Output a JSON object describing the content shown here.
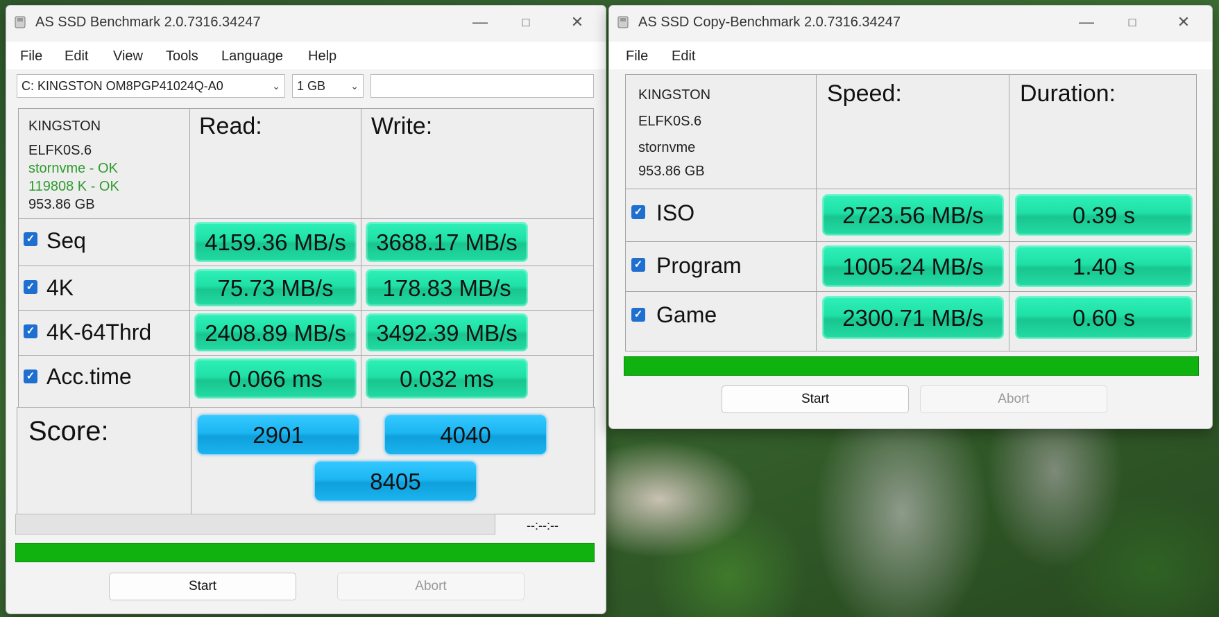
{
  "benchmark": {
    "title": "AS SSD Benchmark 2.0.7316.34247",
    "menu": [
      "File",
      "Edit",
      "View",
      "Tools",
      "Language",
      "Help"
    ],
    "drive_select": "C: KINGSTON OM8PGP41024Q-A0",
    "size_select": "1 GB",
    "info": {
      "model": "KINGSTON",
      "firmware": "ELFK0S.6",
      "driver": "stornvme - OK",
      "alignment": "119808 K - OK",
      "capacity": "953.86 GB"
    },
    "headers": {
      "read": "Read:",
      "write": "Write:"
    },
    "rows": [
      {
        "label": "Seq",
        "checked": true,
        "read": "4159.36 MB/s",
        "write": "3688.17 MB/s"
      },
      {
        "label": "4K",
        "checked": true,
        "read": "75.73 MB/s",
        "write": "178.83 MB/s"
      },
      {
        "label": "4K-64Thrd",
        "checked": true,
        "read": "2408.89 MB/s",
        "write": "3492.39 MB/s"
      },
      {
        "label": "Acc.time",
        "checked": true,
        "read": "0.066 ms",
        "write": "0.032 ms"
      }
    ],
    "score_label": "Score:",
    "score_read": "2901",
    "score_write": "4040",
    "score_total": "8405",
    "time_display": "--:--:--",
    "progress_fraction": 1.0,
    "start_label": "Start",
    "abort_label": "Abort"
  },
  "copy": {
    "title": "AS SSD Copy-Benchmark 2.0.7316.34247",
    "menu": [
      "File",
      "Edit"
    ],
    "info": {
      "model": "KINGSTON",
      "firmware": "ELFK0S.6",
      "driver": "stornvme",
      "capacity": "953.86 GB"
    },
    "headers": {
      "speed": "Speed:",
      "duration": "Duration:"
    },
    "rows": [
      {
        "label": "ISO",
        "checked": true,
        "speed": "2723.56 MB/s",
        "duration": "0.39 s"
      },
      {
        "label": "Program",
        "checked": true,
        "speed": "1005.24 MB/s",
        "duration": "1.40 s"
      },
      {
        "label": "Game",
        "checked": true,
        "speed": "2300.71 MB/s",
        "duration": "0.60 s"
      }
    ],
    "progress_fraction": 1.0,
    "start_label": "Start",
    "abort_label": "Abort"
  },
  "icons": {
    "app": "drive-icon",
    "minimize": "minimize-icon",
    "maximize": "maximize-icon",
    "close": "close-icon",
    "check": "check-icon",
    "dropdown": "chevron-down-icon"
  }
}
